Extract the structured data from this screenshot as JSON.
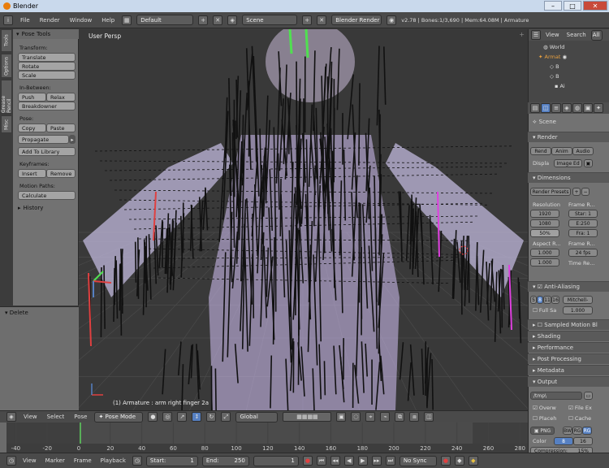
{
  "window": {
    "title": "Blender",
    "min": "–",
    "max": "□",
    "close": "✕"
  },
  "info": {
    "menus": [
      "File",
      "Render",
      "Window",
      "Help"
    ],
    "layout": "Default",
    "scene": "Scene",
    "engine": "Blender Render",
    "stats": "v2.78 | Bones:1/3,690 | Mem:64.08M | Armature"
  },
  "tool_tabs": [
    "Tools",
    "Options",
    "Grease Pencil",
    "Misc"
  ],
  "tools": {
    "header": "Pose Tools",
    "transform_label": "Transform:",
    "translate": "Translate",
    "rotate": "Rotate",
    "scale": "Scale",
    "inbetween_label": "In-Between:",
    "push": "Push",
    "relax": "Relax",
    "breakdowner": "Breakdowner",
    "pose_label": "Pose:",
    "copy": "Copy",
    "paste": "Paste",
    "propagate": "Propagate",
    "add_to_library": "Add To Library",
    "keyframes_label": "Keyframes:",
    "insert": "Insert",
    "remove": "Remove",
    "motion_paths_label": "Motion Paths:",
    "calculate": "Calculate",
    "history": "History",
    "delete": "Delete"
  },
  "viewport": {
    "view_name": "User Persp",
    "status": "(1) Armature : arm right finger 2a"
  },
  "outliner": {
    "view": "View",
    "search": "Search",
    "all": "All",
    "items": [
      "World",
      "Armat",
      "B",
      "B",
      "Ai"
    ]
  },
  "properties": {
    "scene": "Scene",
    "render": "Render",
    "render_btn": "Rend",
    "anim_btn": "Anim",
    "audio_btn": "Audio",
    "display_label": "Displa",
    "display_value": "Image Ed",
    "dimensions": "Dimensions",
    "render_presets": "Render Presets",
    "resolution": "Resolution",
    "frame_range": "Frame R...",
    "res_x": "1920",
    "res_y": "1080",
    "res_pct": "50%",
    "start": "Star: 1",
    "end": "E:250",
    "frame_step": "Fra: 1",
    "aspect": "Aspect R...",
    "frame_rate": "Frame R...",
    "aspect_x": "1.000",
    "aspect_y": "1.000",
    "fps": "24 fps",
    "time_remap": "Time Re...",
    "anti_aliasing": "Anti-Aliasing",
    "aa_5": "5",
    "aa_8": "8",
    "aa_11": "11",
    "aa_16": "16",
    "aa_filter": "Mitchell-",
    "full_sample": "Full Sa",
    "filter_size": "1.000",
    "sampled_motion_blur": "Sampled Motion Bl",
    "shading": "Shading",
    "performance": "Performance",
    "post_processing": "Post Processing",
    "metadata": "Metadata",
    "output": "Output",
    "output_path": "/tmp\\",
    "overwrite": "Overw",
    "file_ext": "File Ex",
    "placeholders": "Placeh",
    "cache": "Cache",
    "format": "PNG",
    "bw": "BW",
    "rgb": "RG",
    "rgba": "RG",
    "color_label": "Color",
    "depth_8": "8",
    "depth_16": "16",
    "compression": "Compression:",
    "compression_value": "15%"
  },
  "view3d_header": {
    "view": "View",
    "select": "Select",
    "pose": "Pose",
    "mode": "Pose Mode",
    "orientation": "Global"
  },
  "timeline": {
    "ticks": [
      "-40",
      "-20",
      "0",
      "20",
      "40",
      "60",
      "80",
      "100",
      "120",
      "140",
      "160",
      "180",
      "200",
      "220",
      "240",
      "260",
      "280"
    ],
    "view": "View",
    "marker": "Marker",
    "frame": "Frame",
    "playback": "Playback",
    "start": "Start:",
    "start_val": "1",
    "end": "End:",
    "end_val": "250",
    "current": "1",
    "sync": "No Sync"
  },
  "colors": {
    "accent": "#5680c2",
    "bone_selected": "#e040e0",
    "bone_active": "#e04040",
    "bone_green": "#50e050",
    "mesh": "#c8b8e8"
  }
}
